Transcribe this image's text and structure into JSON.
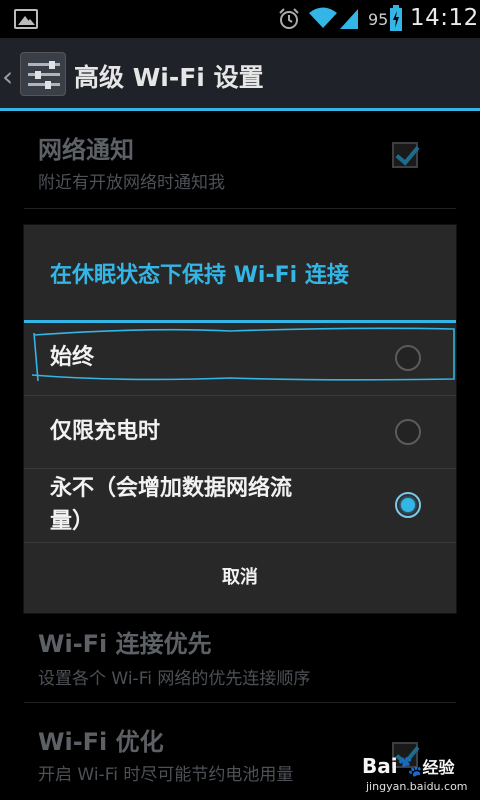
{
  "status_bar": {
    "battery_percent": "95",
    "time": "14:12",
    "icons": [
      "image-icon",
      "alarm-icon",
      "wifi-icon",
      "signal-icon",
      "battery-charging-icon"
    ]
  },
  "action_bar": {
    "title": "高级 Wi-Fi 设置",
    "icon": "settings-sliders-icon"
  },
  "settings": {
    "items": [
      {
        "title": "网络通知",
        "subtitle": "附近有开放网络时通知我",
        "checked": true
      },
      {
        "title": "Wi-Fi 连接优先",
        "subtitle": "设置各个 Wi-Fi 网络的优先连接顺序"
      },
      {
        "title": "Wi-Fi 优化",
        "subtitle": "开启 Wi-Fi 时尽可能节约电池用量",
        "checked": true
      }
    ]
  },
  "dialog": {
    "title": "在休眠状态下保持 Wi-Fi 连接",
    "options": [
      {
        "label": "始终",
        "selected": false
      },
      {
        "label": "仅限充电时",
        "selected": false
      },
      {
        "label_line1": "永不（会增加数据网络流",
        "label_line2": "量）",
        "selected": true
      }
    ],
    "cancel_label": "取消"
  },
  "watermark": {
    "logo": "Bai",
    "logo_suffix": "经验",
    "url": "jingyan.baidu.com"
  },
  "colors": {
    "accent": "#33b5e5",
    "dialog_bg": "#282828",
    "action_bar_bg": "#1f2228"
  }
}
